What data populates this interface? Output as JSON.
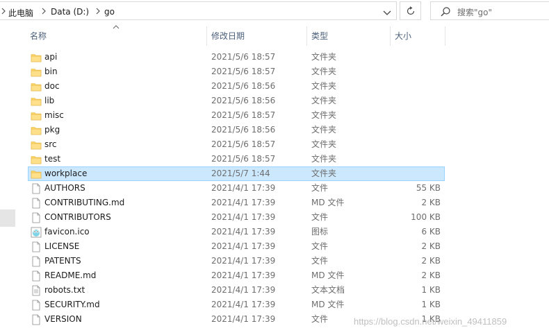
{
  "address_bar": {
    "crumbs": [
      "此电脑",
      "Data (D:)",
      "go"
    ]
  },
  "search": {
    "placeholder": "搜索\"go\""
  },
  "columns": {
    "name": "名称",
    "date": "修改日期",
    "type": "类型",
    "size": "大小"
  },
  "files": [
    {
      "name": "api",
      "date": "2021/5/6 18:57",
      "type": "文件夹",
      "size": "",
      "icon": "folder-icon"
    },
    {
      "name": "bin",
      "date": "2021/5/6 18:57",
      "type": "文件夹",
      "size": "",
      "icon": "folder-icon"
    },
    {
      "name": "doc",
      "date": "2021/5/6 18:56",
      "type": "文件夹",
      "size": "",
      "icon": "folder-icon"
    },
    {
      "name": "lib",
      "date": "2021/5/6 18:56",
      "type": "文件夹",
      "size": "",
      "icon": "folder-icon"
    },
    {
      "name": "misc",
      "date": "2021/5/6 18:57",
      "type": "文件夹",
      "size": "",
      "icon": "folder-icon"
    },
    {
      "name": "pkg",
      "date": "2021/5/6 18:56",
      "type": "文件夹",
      "size": "",
      "icon": "folder-icon"
    },
    {
      "name": "src",
      "date": "2021/5/6 18:57",
      "type": "文件夹",
      "size": "",
      "icon": "folder-icon"
    },
    {
      "name": "test",
      "date": "2021/5/6 18:57",
      "type": "文件夹",
      "size": "",
      "icon": "folder-icon"
    },
    {
      "name": "workplace",
      "date": "2021/5/7 1:44",
      "type": "文件夹",
      "size": "",
      "icon": "folder-icon",
      "selected": true
    },
    {
      "name": "AUTHORS",
      "date": "2021/4/1 17:39",
      "type": "文件",
      "size": "55 KB",
      "icon": "file-icon"
    },
    {
      "name": "CONTRIBUTING.md",
      "date": "2021/4/1 17:39",
      "type": "MD 文件",
      "size": "2 KB",
      "icon": "file-icon"
    },
    {
      "name": "CONTRIBUTORS",
      "date": "2021/4/1 17:39",
      "type": "文件",
      "size": "100 KB",
      "icon": "file-icon"
    },
    {
      "name": "favicon.ico",
      "date": "2021/4/1 17:39",
      "type": "图标",
      "size": "6 KB",
      "icon": "gopher-image-icon"
    },
    {
      "name": "LICENSE",
      "date": "2021/4/1 17:39",
      "type": "文件",
      "size": "2 KB",
      "icon": "file-icon"
    },
    {
      "name": "PATENTS",
      "date": "2021/4/1 17:39",
      "type": "文件",
      "size": "2 KB",
      "icon": "file-icon"
    },
    {
      "name": "README.md",
      "date": "2021/4/1 17:39",
      "type": "MD 文件",
      "size": "2 KB",
      "icon": "file-icon"
    },
    {
      "name": "robots.txt",
      "date": "2021/4/1 17:39",
      "type": "文本文档",
      "size": "1 KB",
      "icon": "text-file-icon"
    },
    {
      "name": "SECURITY.md",
      "date": "2021/4/1 17:39",
      "type": "MD 文件",
      "size": "1 KB",
      "icon": "file-icon"
    },
    {
      "name": "VERSION",
      "date": "2021/4/1 17:39",
      "type": "文件",
      "size": "1 KB",
      "icon": "file-icon"
    }
  ],
  "watermark": "https://blog.csdn.net/weixin_49411859",
  "colors": {
    "selection_bg": "#cce8ff",
    "selection_border": "#99d1ff",
    "folder_yellow": "#ffd766",
    "header_text": "#4c607a"
  }
}
